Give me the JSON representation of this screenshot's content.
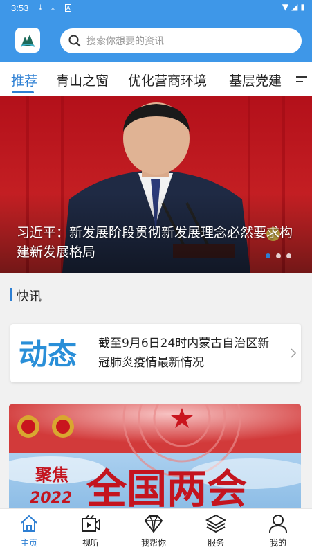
{
  "status_bar": {
    "time": "3:53"
  },
  "header": {
    "search": {
      "placeholder": "搜索你想要的资讯"
    }
  },
  "tabs": [
    {
      "label": "推荐",
      "active": true
    },
    {
      "label": "青山之窗",
      "active": false
    },
    {
      "label": "优化营商环境",
      "active": false
    },
    {
      "label": "基层党建",
      "active": false
    }
  ],
  "banner": {
    "caption": "习近平：新发展阶段贯彻新发展理念必然要求构建新发展格局",
    "slide_count": 3,
    "active_slide": 1
  },
  "section": {
    "title": "快讯"
  },
  "news": {
    "tag_text": "动态",
    "headline": "截至9月6日24时内蒙古自治区新冠肺炎疫情最新情况"
  },
  "promo": {
    "small_title": "聚焦",
    "year": "2022",
    "big_title": "全国两会"
  },
  "bottom_nav": [
    {
      "label": "主页",
      "icon": "home-icon",
      "active": true
    },
    {
      "label": "视听",
      "icon": "video-icon",
      "active": false
    },
    {
      "label": "我帮你",
      "icon": "diamond-icon",
      "active": false
    },
    {
      "label": "服务",
      "icon": "layers-icon",
      "active": false
    },
    {
      "label": "我的",
      "icon": "user-icon",
      "active": false
    }
  ],
  "colors": {
    "accent": "#2d7fd3",
    "header_bg": "#3e97e8",
    "banner_red": "#b8151a"
  }
}
